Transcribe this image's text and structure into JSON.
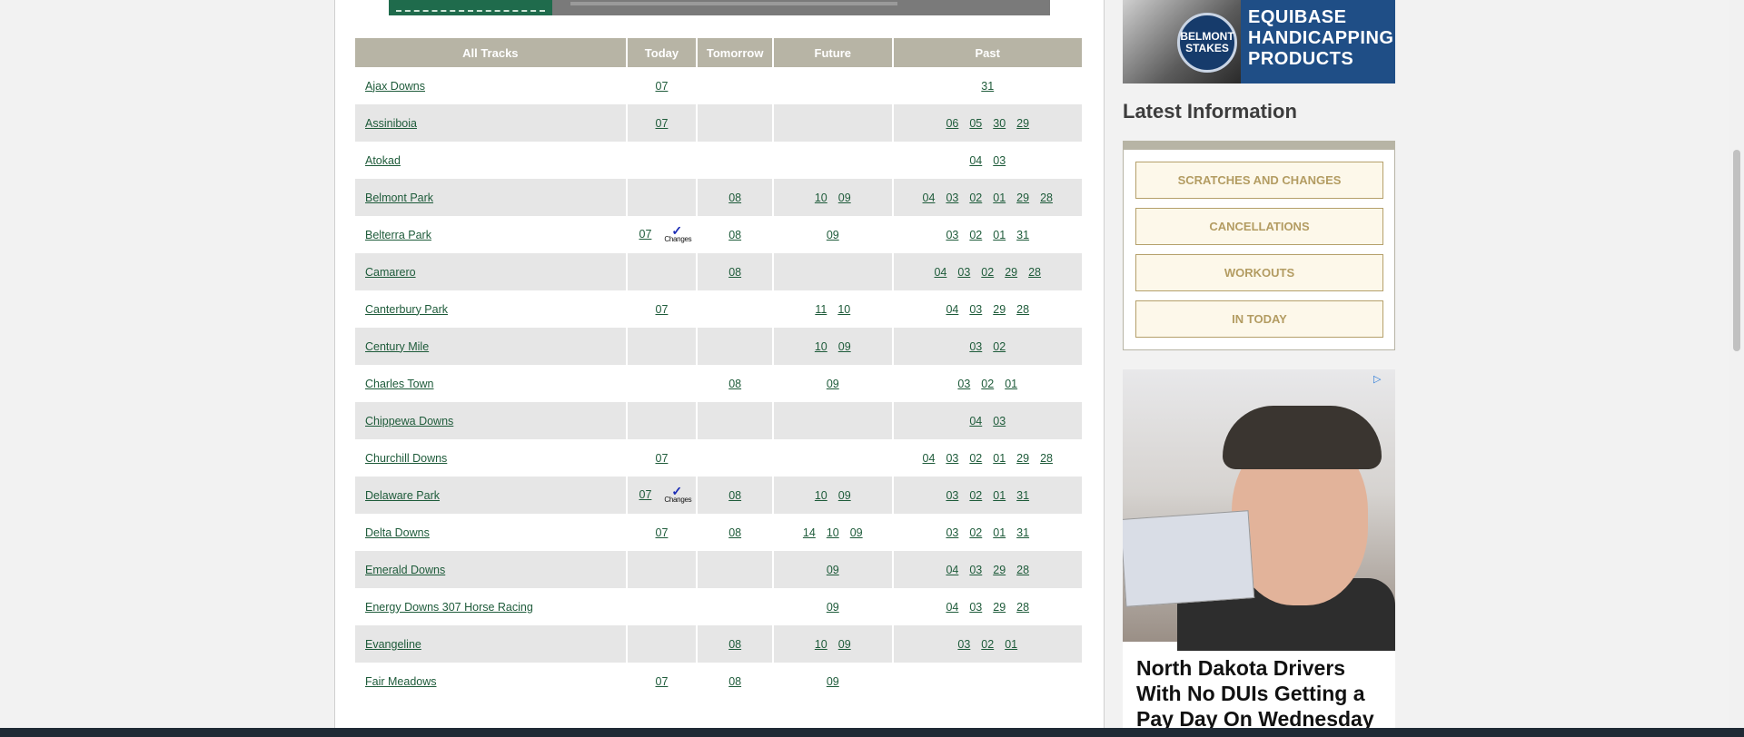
{
  "header": {
    "all_tracks": "All Tracks",
    "today": "Today",
    "tomorrow": "Tomorrow",
    "future": "Future",
    "past": "Past"
  },
  "changes_label": "Changes",
  "tracks": [
    {
      "name": "Ajax Downs",
      "today": [
        "07"
      ],
      "tomorrow": [],
      "future": [],
      "past": [
        "31"
      ]
    },
    {
      "name": "Assiniboia",
      "today": [
        "07"
      ],
      "tomorrow": [],
      "future": [],
      "past": [
        "06",
        "05",
        "30",
        "29"
      ]
    },
    {
      "name": "Atokad",
      "today": [],
      "tomorrow": [],
      "future": [],
      "past": [
        "04",
        "03"
      ]
    },
    {
      "name": "Belmont Park",
      "today": [],
      "tomorrow": [
        "08"
      ],
      "future": [
        "10",
        "09"
      ],
      "past": [
        "04",
        "03",
        "02",
        "01",
        "29",
        "28"
      ]
    },
    {
      "name": "Belterra Park",
      "today": [
        "07"
      ],
      "changes": true,
      "tomorrow": [
        "08"
      ],
      "future": [
        "09"
      ],
      "past": [
        "03",
        "02",
        "01",
        "31"
      ]
    },
    {
      "name": "Camarero",
      "today": [],
      "tomorrow": [
        "08"
      ],
      "future": [],
      "past": [
        "04",
        "03",
        "02",
        "29",
        "28"
      ]
    },
    {
      "name": "Canterbury Park",
      "today": [
        "07"
      ],
      "tomorrow": [],
      "future": [
        "11",
        "10"
      ],
      "past": [
        "04",
        "03",
        "29",
        "28"
      ]
    },
    {
      "name": "Century Mile",
      "today": [],
      "tomorrow": [],
      "future": [
        "10",
        "09"
      ],
      "past": [
        "03",
        "02"
      ]
    },
    {
      "name": "Charles Town",
      "today": [],
      "tomorrow": [
        "08"
      ],
      "future": [
        "09"
      ],
      "past": [
        "03",
        "02",
        "01"
      ]
    },
    {
      "name": "Chippewa Downs",
      "today": [],
      "tomorrow": [],
      "future": [],
      "past": [
        "04",
        "03"
      ]
    },
    {
      "name": "Churchill Downs",
      "today": [
        "07"
      ],
      "tomorrow": [],
      "future": [],
      "past": [
        "04",
        "03",
        "02",
        "01",
        "29",
        "28"
      ]
    },
    {
      "name": "Delaware Park",
      "today": [
        "07"
      ],
      "changes": true,
      "tomorrow": [
        "08"
      ],
      "future": [
        "10",
        "09"
      ],
      "past": [
        "03",
        "02",
        "01",
        "31"
      ]
    },
    {
      "name": "Delta Downs",
      "today": [
        "07"
      ],
      "tomorrow": [
        "08"
      ],
      "future": [
        "14",
        "10",
        "09"
      ],
      "past": [
        "03",
        "02",
        "01",
        "31"
      ]
    },
    {
      "name": "Emerald Downs",
      "today": [],
      "tomorrow": [],
      "future": [
        "09"
      ],
      "past": [
        "04",
        "03",
        "29",
        "28"
      ]
    },
    {
      "name": "Energy Downs 307 Horse Racing",
      "today": [],
      "tomorrow": [],
      "future": [
        "09"
      ],
      "past": [
        "04",
        "03",
        "29",
        "28"
      ]
    },
    {
      "name": "Evangeline",
      "today": [],
      "tomorrow": [
        "08"
      ],
      "future": [
        "10",
        "09"
      ],
      "past": [
        "03",
        "02",
        "01"
      ]
    },
    {
      "name": "Fair Meadows",
      "today": [
        "07"
      ],
      "tomorrow": [
        "08"
      ],
      "future": [
        "09"
      ],
      "past": []
    }
  ],
  "sidebar": {
    "promo_seal": "BELMONT STAKES",
    "promo_line1": "EQUIBASE",
    "promo_line2": "HANDICAPPING",
    "promo_line3": "PRODUCTS",
    "latest_title": "Latest Information",
    "buttons": [
      "SCRATCHES AND CHANGES",
      "CANCELLATIONS",
      "WORKOUTS",
      "IN TODAY"
    ],
    "ad_headline": "North Dakota Drivers With No DUIs Getting a Pay Day On Wednesday"
  },
  "colors": {
    "header_bg": "#b7b4a5",
    "link": "#1e5b3a",
    "row_shade": "#e6e6e6",
    "accent_gold": "#b39c62"
  }
}
